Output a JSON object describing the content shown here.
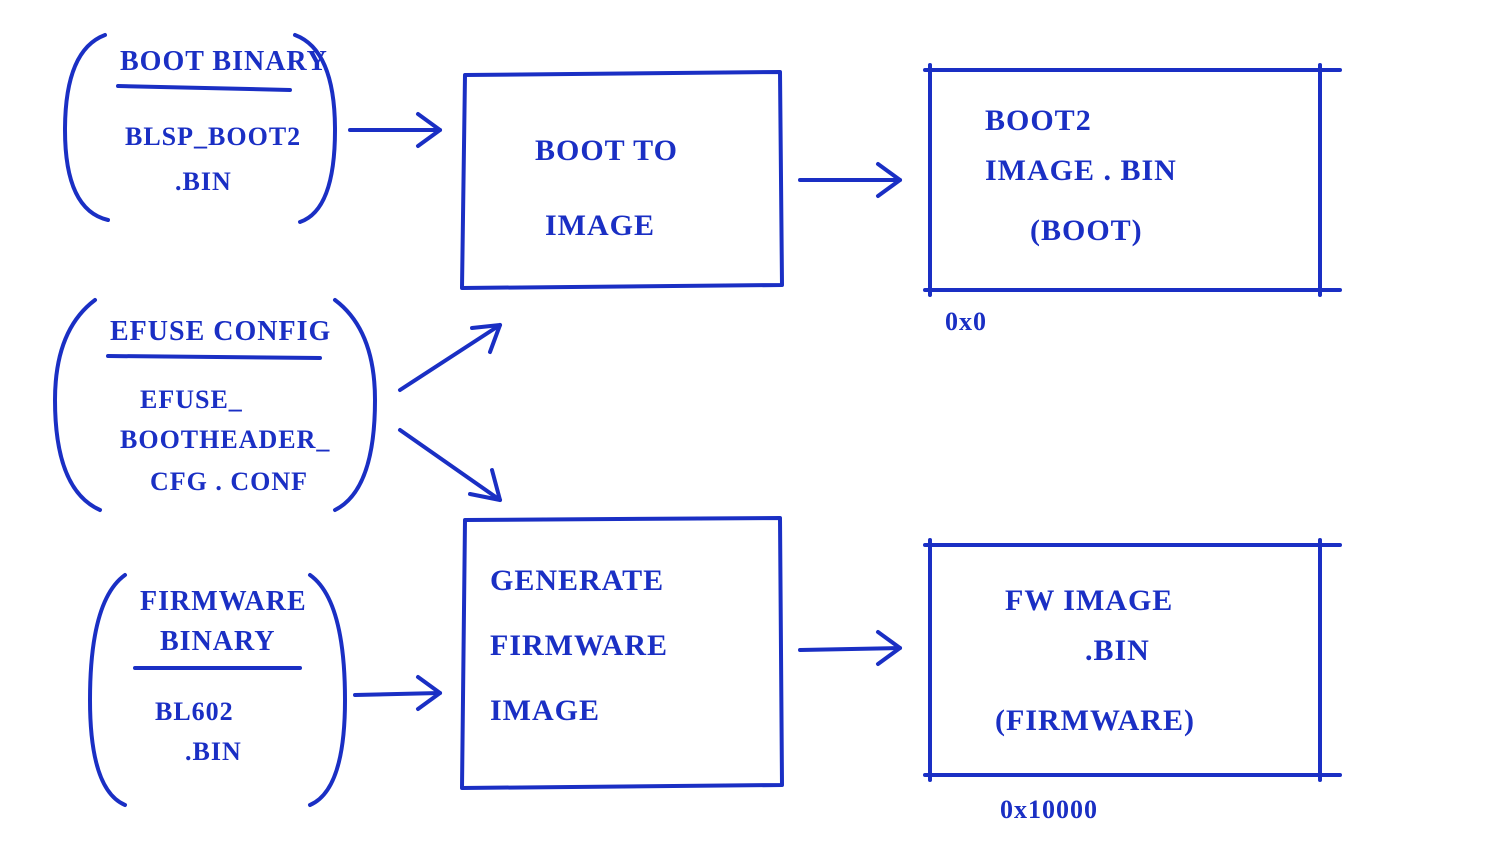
{
  "boot_binary": {
    "header": "BOOT BINARY",
    "line1": "BLSP_BOOT2",
    "line2": ".BIN"
  },
  "efuse_config": {
    "header": "EFUSE CONFIG",
    "line1": "EFUSE_",
    "line2": "BOOTHEADER_",
    "line3": "CFG . CONF"
  },
  "fw_binary": {
    "header": "FIRMWARE",
    "header2": "BINARY",
    "line1": "BL602",
    "line2": ".BIN"
  },
  "process_boot": {
    "line1": "BOOT TO",
    "line2": "IMAGE"
  },
  "process_fw": {
    "line1": "GENERATE",
    "line2": "FIRMWARE",
    "line3": "IMAGE"
  },
  "output_boot": {
    "line1": "BOOT2",
    "line2": "IMAGE . BIN",
    "line3": "(BOOT)",
    "addr": "0x0"
  },
  "output_fw": {
    "line1": "FW IMAGE",
    "line2": ".BIN",
    "line3": "(FIRMWARE)",
    "addr": "0x10000"
  }
}
